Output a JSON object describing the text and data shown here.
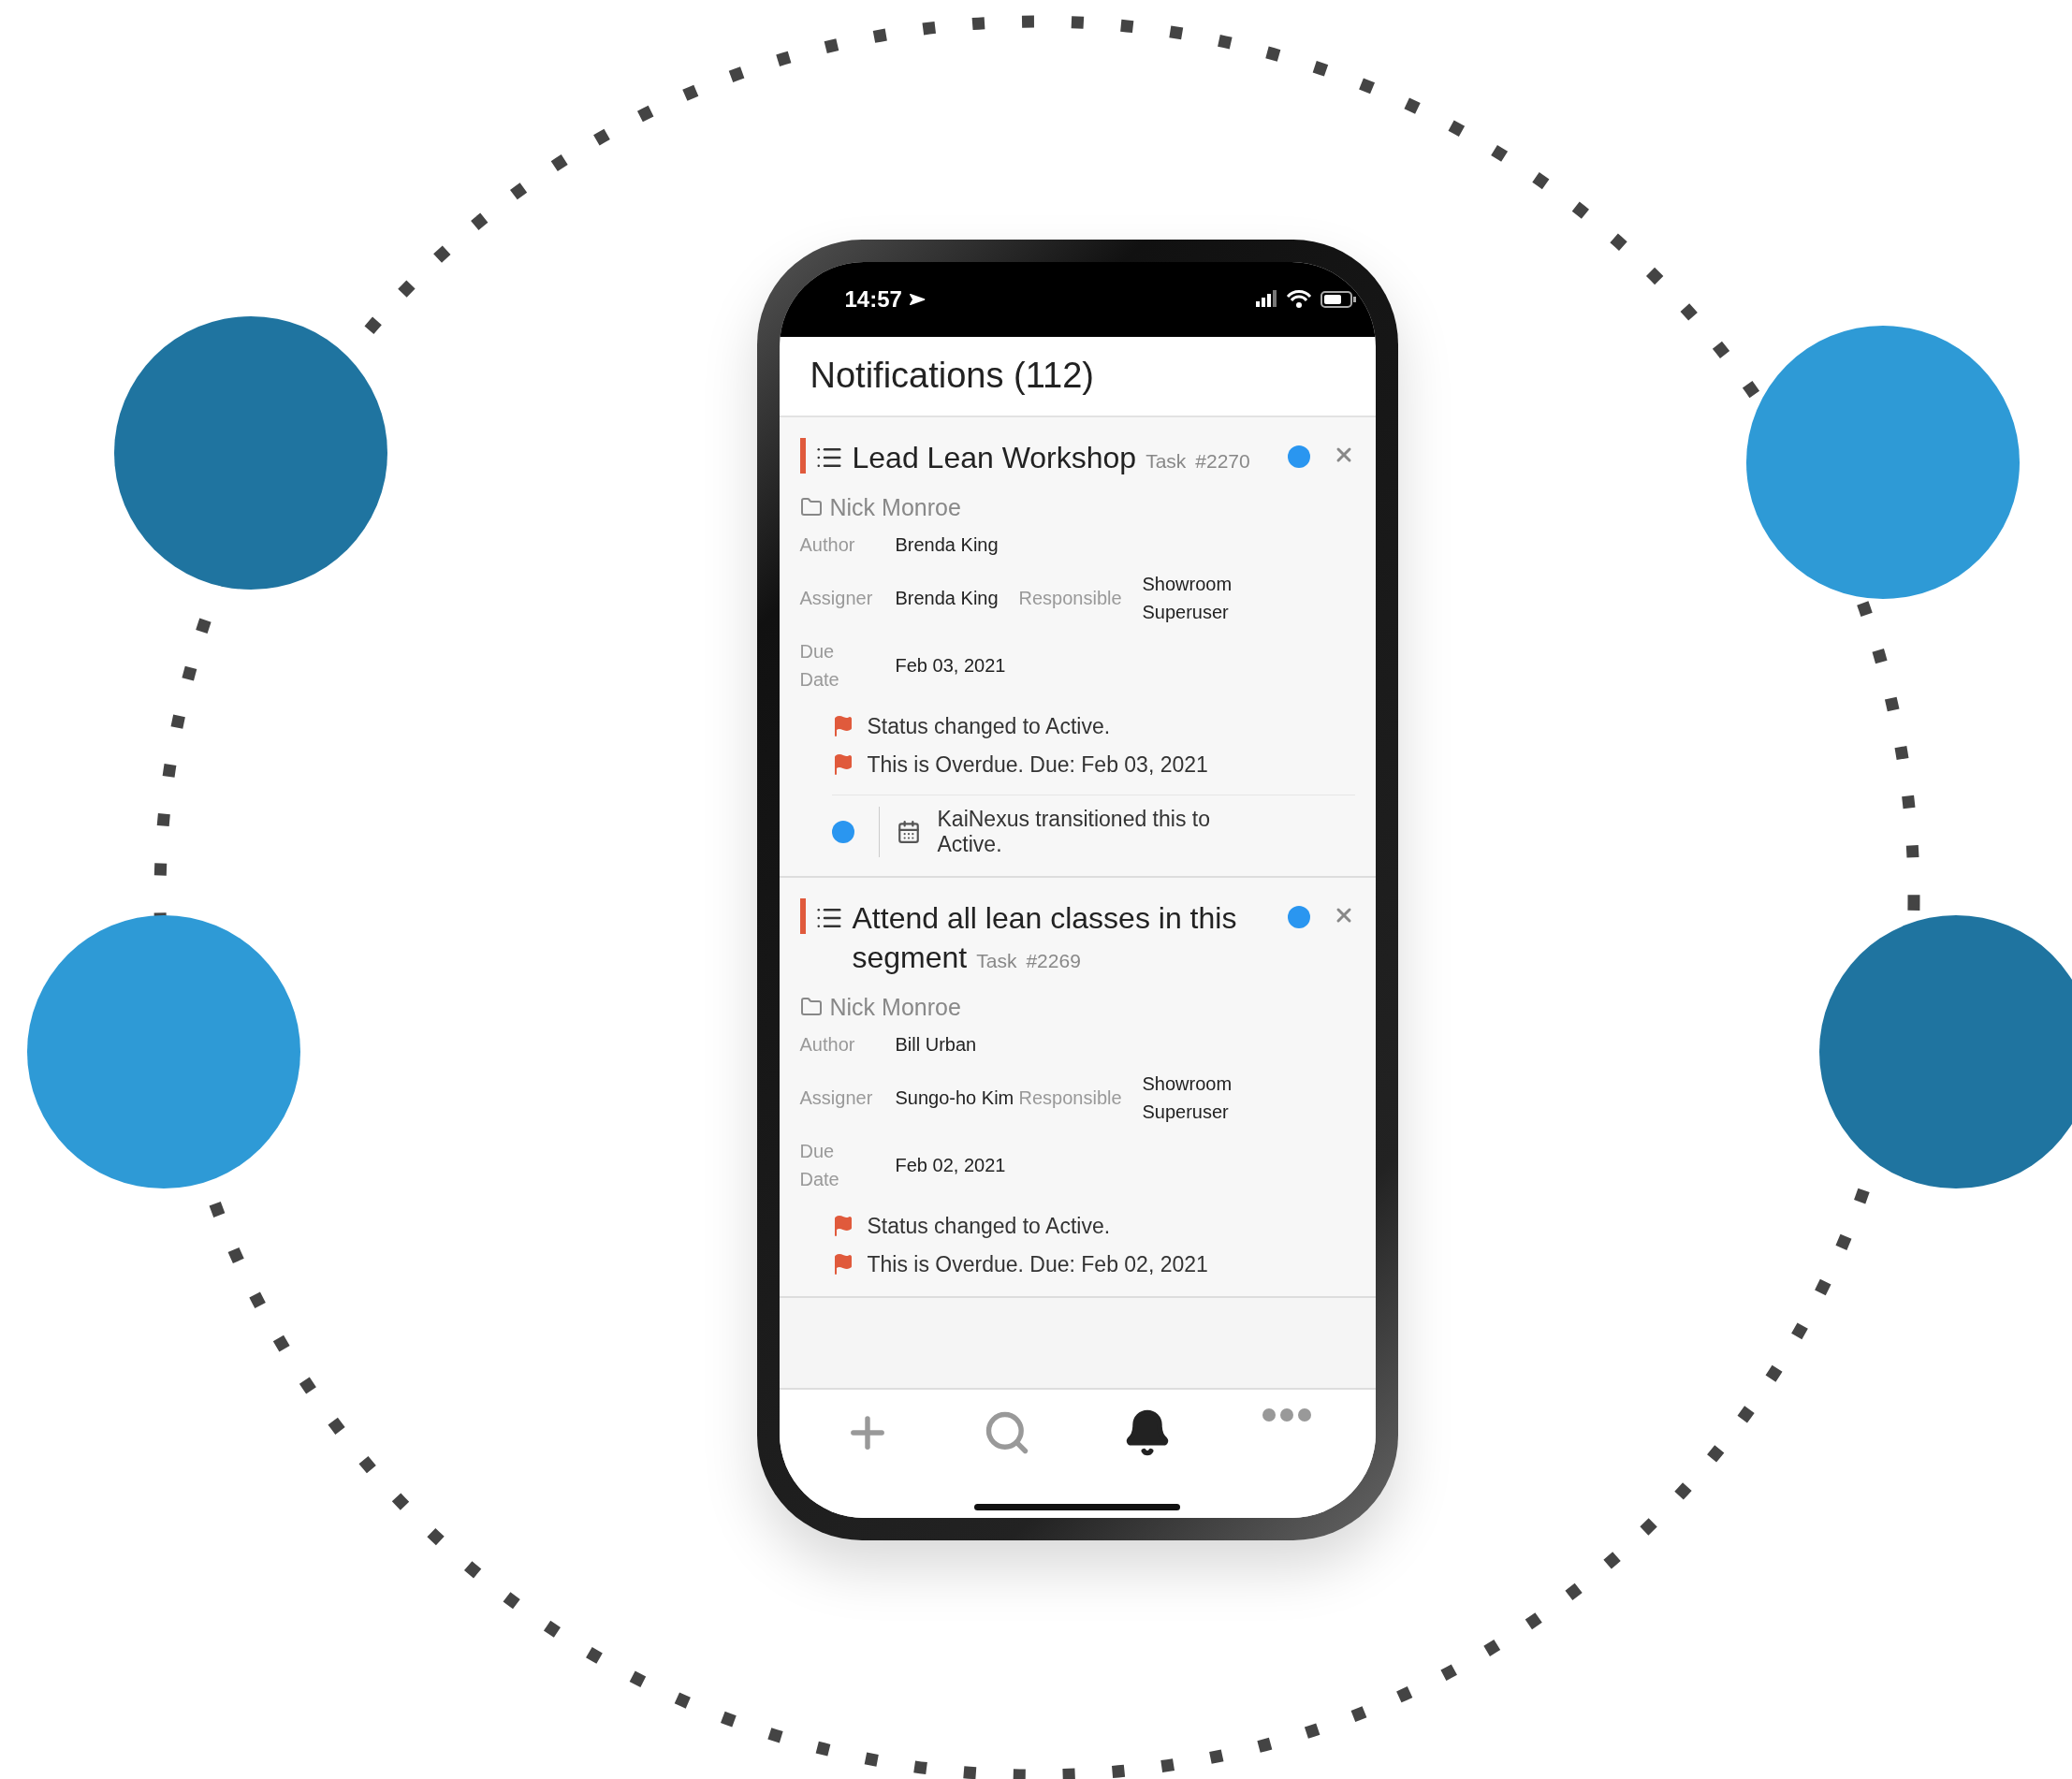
{
  "status_bar": {
    "time": "14:57"
  },
  "header": {
    "title": "Notifications (112)"
  },
  "notifications": [
    {
      "title": "Lead Lean Workshop",
      "type": "Task",
      "number": "#2270",
      "unread": true,
      "owner": "Nick Monroe",
      "labels": {
        "author": "Author",
        "assigner": "Assigner",
        "responsible": "Responsible",
        "due": "Due Date"
      },
      "author": "Brenda King",
      "assigner": "Brenda King",
      "responsible": "Showroom Superuser",
      "due": "Feb 03, 2021",
      "events": [
        "Status changed to Active.",
        "This is Overdue. Due: Feb 03, 2021"
      ],
      "activity": {
        "text": "KaiNexus transitioned this to Active.",
        "unread": true
      }
    },
    {
      "title": "Attend all lean classes in this segment",
      "type": "Task",
      "number": "#2269",
      "unread": true,
      "owner": "Nick Monroe",
      "labels": {
        "author": "Author",
        "assigner": "Assigner",
        "responsible": "Responsible",
        "due": "Due Date"
      },
      "author": "Bill Urban",
      "assigner": "Sungo-ho Kim",
      "responsible": "Showroom Superuser",
      "due": "Feb 02, 2021",
      "events": [
        "Status changed to Active.",
        "This is Overdue. Due: Feb 02, 2021"
      ]
    }
  ],
  "tab_bar": [
    {
      "kind": "add",
      "selected": false
    },
    {
      "kind": "search",
      "selected": false
    },
    {
      "kind": "notifications",
      "selected": true
    },
    {
      "kind": "more",
      "selected": false
    }
  ]
}
